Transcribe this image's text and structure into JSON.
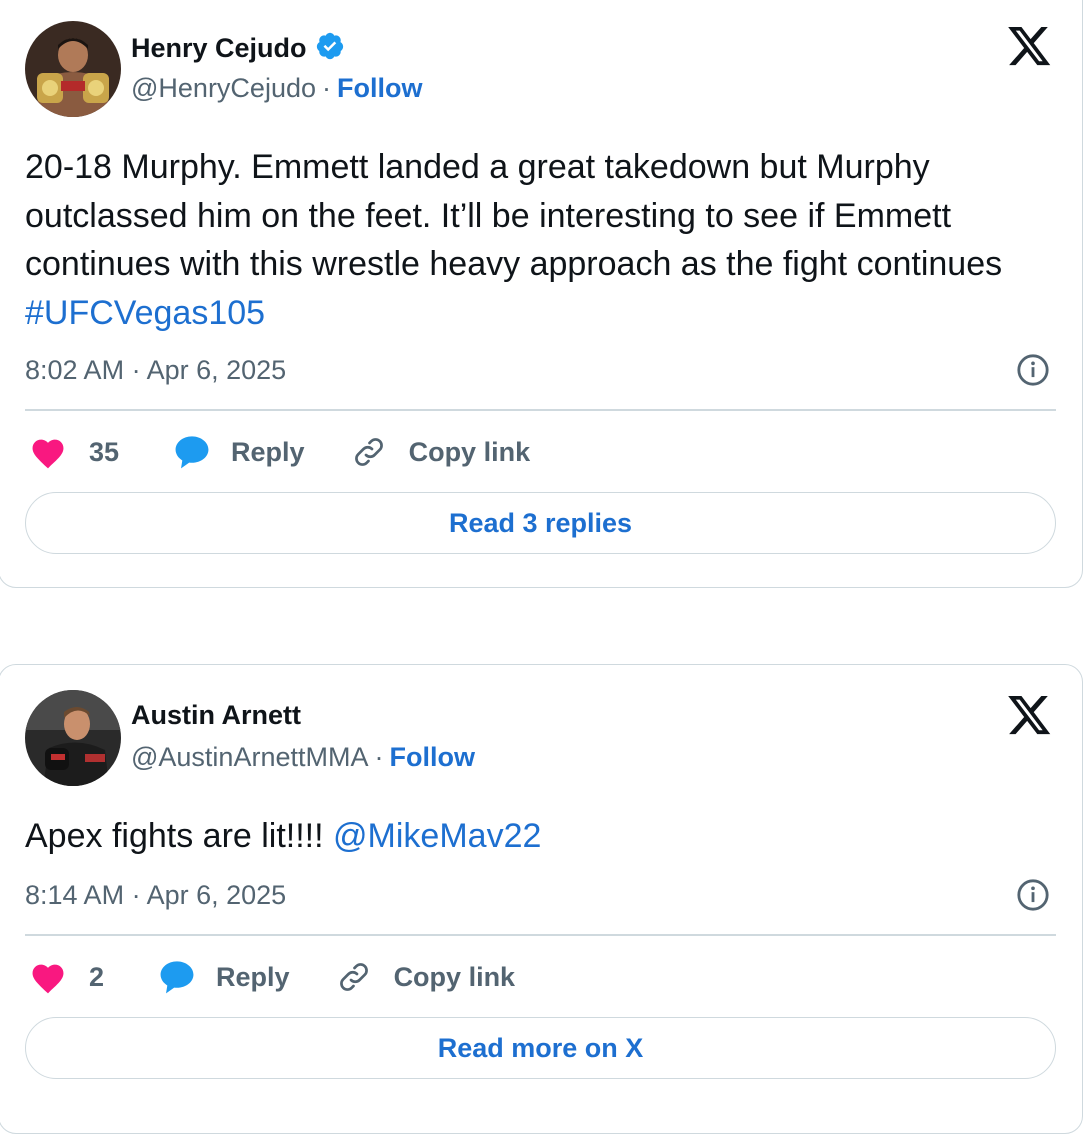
{
  "tweets": [
    {
      "author_name": "Henry Cejudo",
      "verified": true,
      "handle": "@HenryCejudo",
      "separator": "·",
      "follow_label": "Follow",
      "text_plain": "20-18 Murphy. Emmett landed a great takedown but Murphy outclassed him on the feet. It’ll be interesting to see if Emmett continues with this wrestle heavy approach as the fight continues ",
      "text_link": "#UFCVegas105",
      "timestamp": "8:02 AM · Apr 6, 2025",
      "like_count": "35",
      "reply_label": "Reply",
      "copy_link_label": "Copy link",
      "footer_button_label": "Read 3 replies"
    },
    {
      "author_name": "Austin Arnett",
      "verified": false,
      "handle": "@AustinArnettMMA",
      "separator": "·",
      "follow_label": "Follow",
      "text_plain": "Apex fights are lit!!!! ",
      "text_link": "@MikeMav22",
      "timestamp": "8:14 AM · Apr 6, 2025",
      "like_count": "2",
      "reply_label": "Reply",
      "copy_link_label": "Copy link",
      "footer_button_label": "Read more on X"
    }
  ],
  "colors": {
    "link_blue": "#1d6fd0",
    "heart_pink": "#f91880",
    "reply_blue": "#1d9bf0",
    "verified_blue": "#1d9bf0",
    "border": "#cfd9de",
    "muted_text": "#536471"
  },
  "icons": {
    "verified": "verified-badge-icon",
    "x_logo": "x-logo-icon",
    "info": "info-icon",
    "like": "heart-icon",
    "reply": "reply-bubble-icon",
    "copy_link": "link-icon"
  }
}
